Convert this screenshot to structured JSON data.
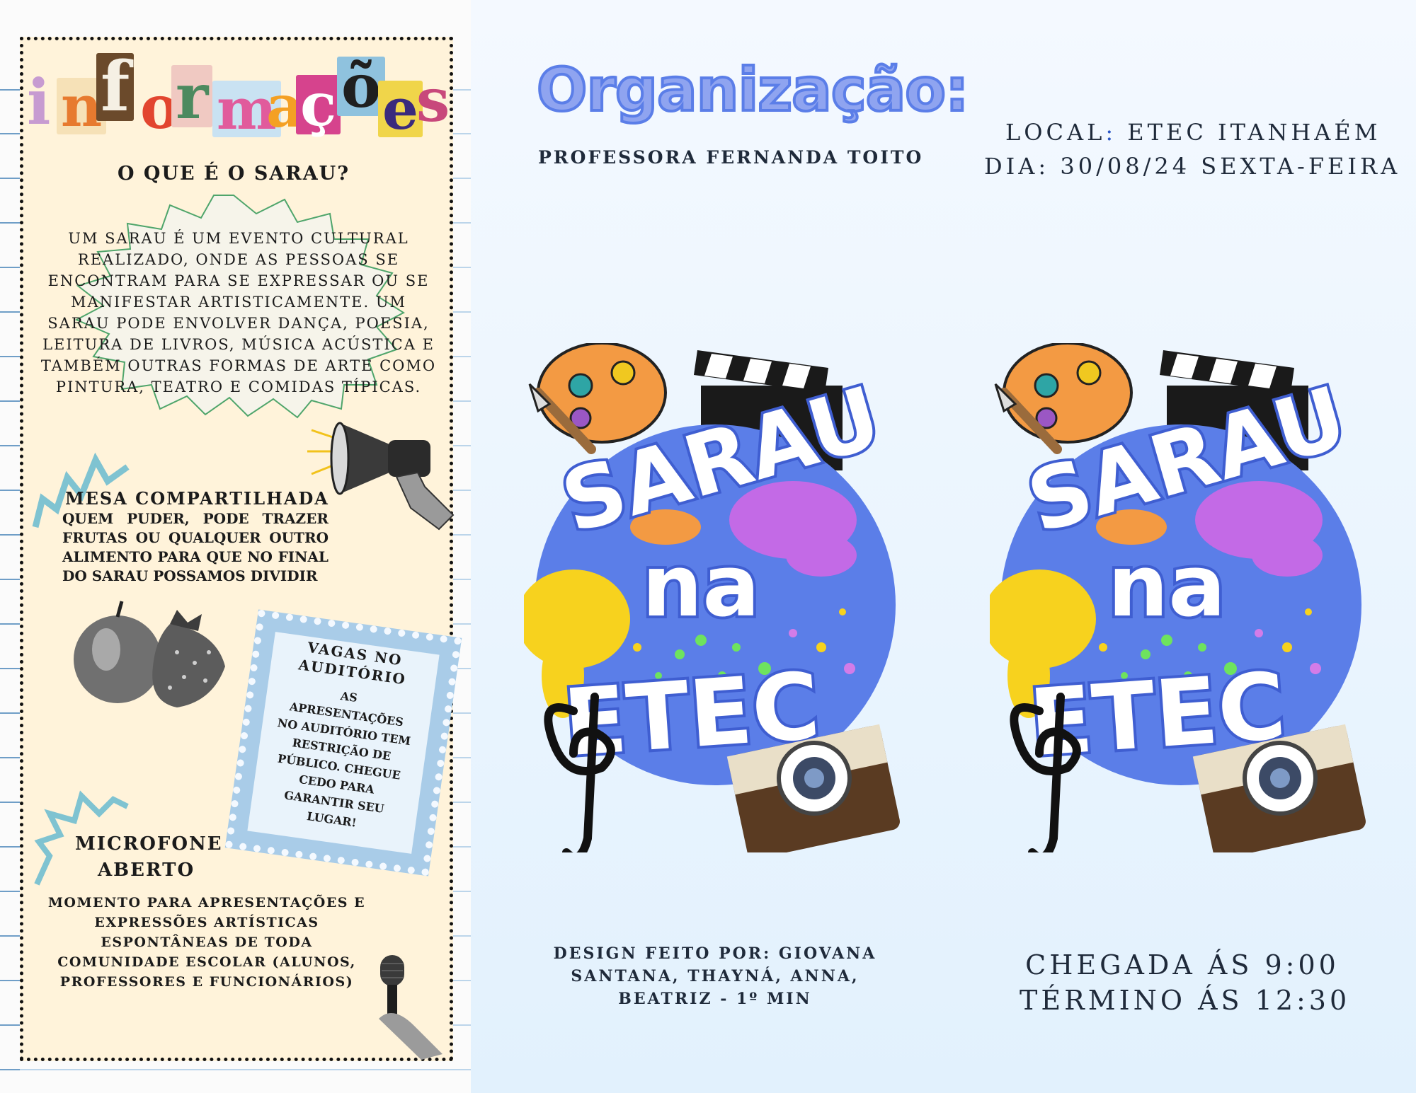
{
  "left": {
    "title": "informações",
    "title_letters": [
      "i",
      "n",
      "f",
      "o",
      "r",
      "m",
      "a",
      "ç",
      "õ",
      "e",
      "s"
    ],
    "sarau_heading": "O QUE É O SARAU?",
    "sarau_text": "UM SARAU É UM EVENTO CULTURAL REALIZADO, ONDE AS PESSOAS SE ENCONTRAM PARA SE EXPRESSAR OU SE MANIFESTAR ARTISTICAMENTE. UM SARAU PODE ENVOLVER DANÇA, POESIA, LEITURA DE LIVROS, MÚSICA ACÚSTICA E TAMBÉM OUTRAS FORMAS DE ARTE COMO PINTURA, TEATRO E COMIDAS TÍPICAS.",
    "mesa_heading": "MESA COMPARTILHADA",
    "mesa_text": "QUEM PUDER, PODE TRAZER FRUTAS OU QUALQUER OUTRO ALIMENTO PARA QUE NO FINAL DO SARAU POSSAMOS DIVIDIR",
    "vagas_heading": "VAGAS NO AUDITÓRIO",
    "vagas_text": "AS APRESENTAÇÕES NO AUDITÓRIO TEM RESTRIÇÃO DE PÚBLICO. CHEGUE CEDO PARA GARANTIR SEU LUGAR!",
    "microfone_heading_1": "MICROFONE",
    "microfone_heading_2": "ABERTO",
    "microfone_text": "MOMENTO PARA APRESENTAÇÕES E EXPRESSÕES ARTÍSTICAS ESPONTÂNEAS DE TODA COMUNIDADE ESCOLAR (ALUNOS, PROFESSORES E FUNCIONÁRIOS)"
  },
  "right": {
    "organizacao_title": "Organização:",
    "organizacao_name": "PROFESSORA FERNANDA TOITO",
    "local_label": "LOCAL",
    "local_sep": ":",
    "local_value": " ETEC ITANHAÉM",
    "dia": "DIA: 30/08/24 SEXTA-FEIRA",
    "design_credit": "DESIGN FEITO POR: GIOVANA SANTANA, THAYNÁ, ANNA, BEATRIZ - 1º MIN",
    "chegada": "CHEGADA ÁS 9:00",
    "termino": "TÉRMINO ÁS 12:30"
  },
  "logo": {
    "line1": "SARAU",
    "line2": "na",
    "line3": "ETEC"
  },
  "colors": {
    "accent_blue": "#5b7ee8",
    "title_fill": "#8fa4f0",
    "green_zigzag": "#4fa56b",
    "teal_zigzag": "#7fc3d1",
    "stamp_blue": "#a9cce8",
    "local_sep": "#2a56c6"
  }
}
